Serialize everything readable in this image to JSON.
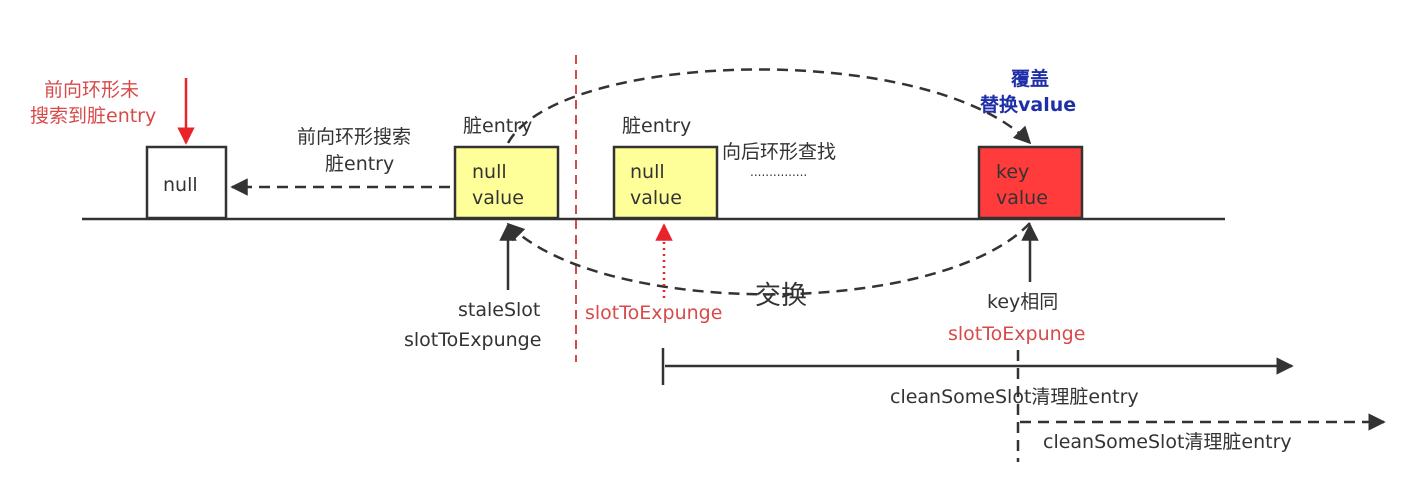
{
  "colors": {
    "null_box": "#ffffff",
    "dirty_box": "#ffff99",
    "key_box": "#ff3b3b",
    "accent_red": "#d84a4a",
    "accent_blue": "#1f2fa8",
    "line": "#333333"
  },
  "boxes": {
    "null_slot": {
      "line1": "null"
    },
    "stale_slot": {
      "line1": "null",
      "line2": "value"
    },
    "expunge_slot": {
      "line1": "null",
      "line2": "value"
    },
    "key_slot": {
      "line1": "key",
      "line2": "value"
    }
  },
  "labels": {
    "forward_not_found_1": "前向环形未",
    "forward_not_found_2": "搜索到脏entry",
    "forward_search_1": "前向环形搜索",
    "forward_search_2": "脏entry",
    "dirty_entry_1": "脏entry",
    "dirty_entry_2": "脏entry",
    "backward_search": "向后环形查找",
    "dots": "...............",
    "overwrite_1": "覆盖",
    "overwrite_2": "替换value",
    "stale_slot": "staleSlot",
    "slot_to_expunge_1": "slotToExpunge",
    "slot_to_expunge_2": "slotToExpunge",
    "swap": "交换",
    "key_same": "key相同",
    "slot_to_expunge_3": "slotToExpunge",
    "clean_some_slot_1": "cleanSomeSlot清理脏entry",
    "clean_some_slot_2": "cleanSomeSlot清理脏entry"
  }
}
